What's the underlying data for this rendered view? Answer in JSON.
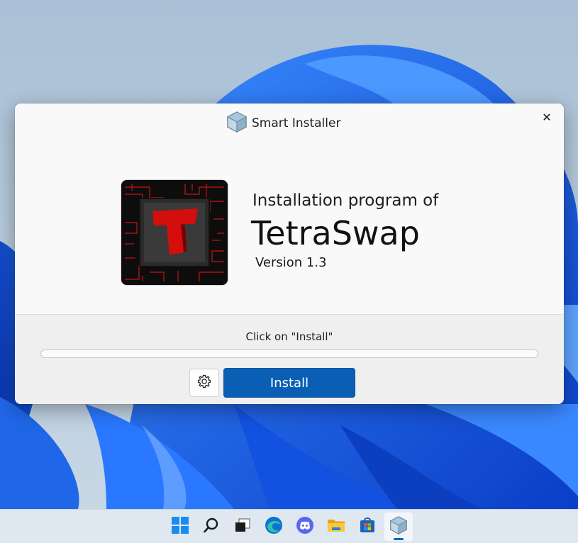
{
  "window": {
    "title": "Smart Installer",
    "close_symbol": "✕"
  },
  "app": {
    "logo_icon": "tetraswap-logo-icon",
    "heading": "Installation program of",
    "name": "TetraSwap",
    "version": "Version 1.3"
  },
  "footer": {
    "status": "Click on \"Install\"",
    "progress": 0,
    "settings_icon": "gear-icon",
    "install_label": "Install"
  },
  "taskbar": {
    "items": [
      {
        "name": "start",
        "icon": "windows-start-icon"
      },
      {
        "name": "search",
        "icon": "search-icon"
      },
      {
        "name": "task-view",
        "icon": "task-view-icon"
      },
      {
        "name": "edge",
        "icon": "edge-browser-icon"
      },
      {
        "name": "discord",
        "icon": "discord-icon"
      },
      {
        "name": "file-explorer",
        "icon": "folder-icon"
      },
      {
        "name": "store",
        "icon": "store-icon"
      },
      {
        "name": "smart-installer",
        "icon": "installer-cube-icon",
        "active": true
      }
    ]
  },
  "colors": {
    "accent": "#0a5fb4",
    "logo_red": "#d40d0d",
    "taskbar_indicator": "#0067c0"
  }
}
